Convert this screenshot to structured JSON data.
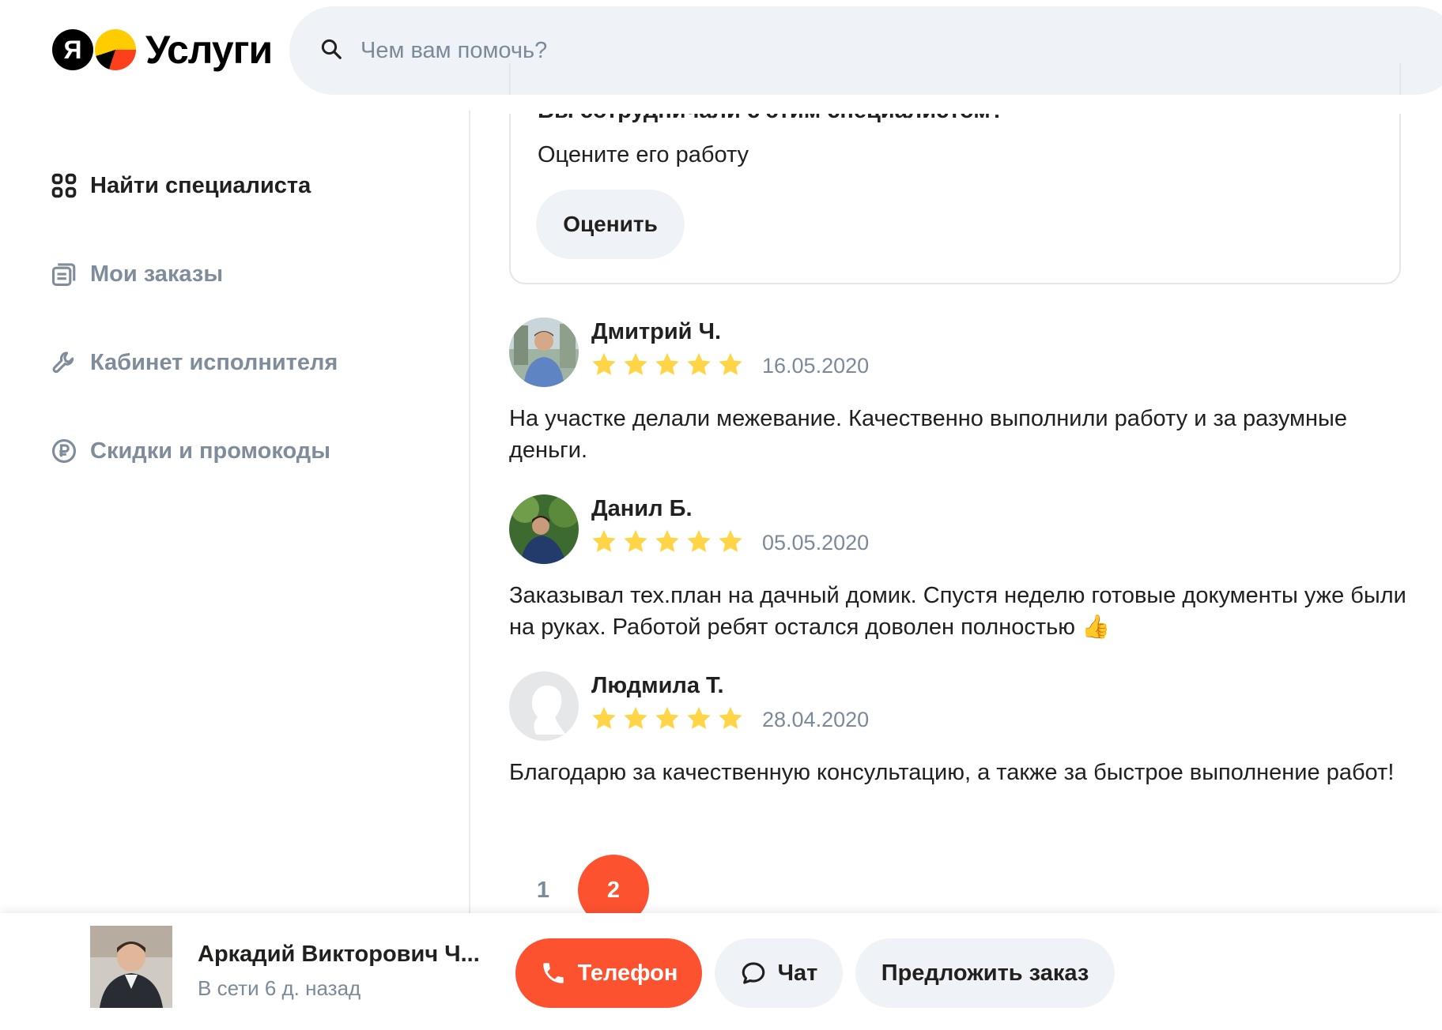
{
  "header": {
    "logo_text": "Услуги",
    "search_placeholder": "Чем вам помочь?"
  },
  "sidebar": {
    "items": [
      {
        "label": "Найти специалиста",
        "icon": "grid-icon"
      },
      {
        "label": "Мои заказы",
        "icon": "orders-icon"
      },
      {
        "label": "Кабинет исполнителя",
        "icon": "wrench-icon"
      },
      {
        "label": "Скидки и промокоды",
        "icon": "ruble-icon"
      }
    ]
  },
  "rate_card": {
    "title": "Вы сотрудничали с этим специалистом?",
    "subtitle": "Оцените его работу",
    "button": "Оценить"
  },
  "reviews": [
    {
      "name": "Дмитрий Ч.",
      "rating": 5,
      "date": "16.05.2020",
      "text": "На участке делали межевание. Качественно выполнили работу и за разумные деньги."
    },
    {
      "name": "Данил Б.",
      "rating": 5,
      "date": "05.05.2020",
      "text": "Заказывал тех.план на дачный домик. Спустя неделю готовые документы уже были на руках. Работой ребят остался доволен полностью 👍"
    },
    {
      "name": "Людмила Т.",
      "rating": 5,
      "date": "28.04.2020",
      "text": "Благодарю за качественную консультацию, а также за быстрое выполнение работ!"
    }
  ],
  "pagination": {
    "pages": [
      "1",
      "2"
    ],
    "current": "2"
  },
  "bottom_bar": {
    "name": "Аркадий Викторович Ч...",
    "status": "В сети 6 д. назад",
    "phone_button": "Телефон",
    "chat_button": "Чат",
    "offer_button": "Предложить заказ"
  },
  "colors": {
    "accent": "#fc5230",
    "star": "#ffd447",
    "muted_text": "#7b8a99",
    "button_bg": "#eff3f7"
  }
}
